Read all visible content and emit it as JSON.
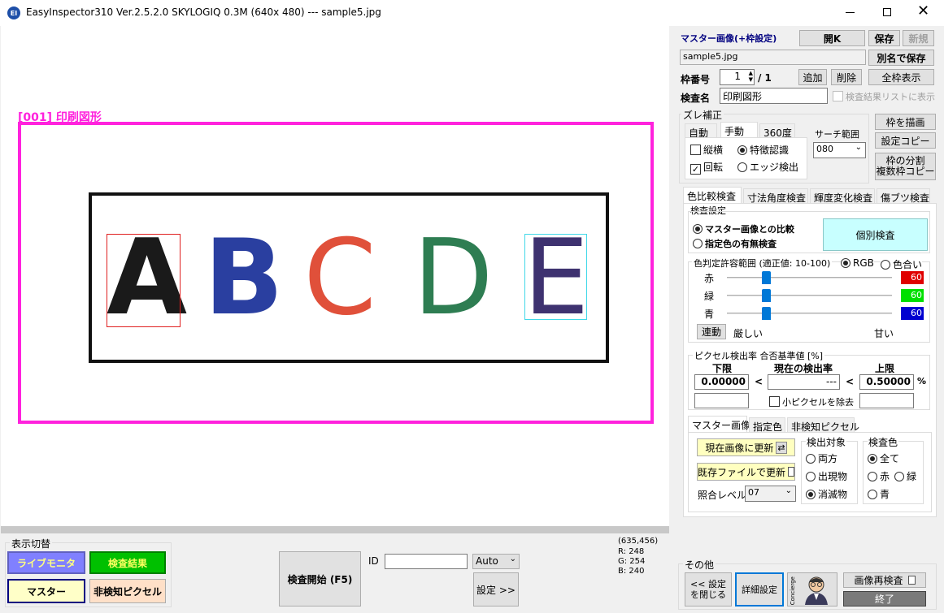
{
  "window": {
    "icon": "EI",
    "title": "EasyInspector310 Ver.2.5.2.0 SKYLOGIQ 0.3M   (640x 480) --- sample5.jpg"
  },
  "image": {
    "frame_label": "[001] 印刷図形",
    "letters": [
      "A",
      "B",
      "C",
      "D",
      "E"
    ],
    "colors": {
      "A": "#1a1a1a",
      "B": "#2a3fa0",
      "C": "#e0503a",
      "D": "#2e7d52",
      "E": "#3e3270",
      "frame": "#ff22dd"
    }
  },
  "bottom": {
    "display_group": "表示切替",
    "live_monitor": "ライブモニタ",
    "result": "検査結果",
    "master": "マスター",
    "non_detect": "非検知ピクセル",
    "start": "検査開始 (F5)",
    "id_label": "ID",
    "id_value": "",
    "auto": "Auto",
    "settings": "設定 >>",
    "coord": "(635,456)",
    "r": "R: 248",
    "g": "G: 254",
    "b": "B: 240",
    "other_group": "その他",
    "close_settings_1": "<< 設定",
    "close_settings_2": "を閉じる",
    "detail": "詳細設定",
    "concierge": "Concierge",
    "reinspect": "画像再検査",
    "exit": "終了"
  },
  "panel": {
    "master_title": "マスター画像(+枠設定)",
    "open": "開K",
    "save": "保存",
    "new": "新規",
    "filename": "sample5.jpg",
    "save_as": "別名で保存",
    "frame_no_label": "枠番号",
    "frame_no": "1",
    "frame_total": "/ 1",
    "add": "追加",
    "delete": "削除",
    "show_all": "全枠表示",
    "inspect_name_label": "検査名",
    "inspect_name": "印刷図形",
    "result_list": "検査結果リストに表示",
    "shift_group": "ズレ補正",
    "tabs": [
      "自動",
      "手動",
      "360度"
    ],
    "vert_horiz": "縦横",
    "rotate": "回転",
    "feature": "特徴認識",
    "edge": "エッジ検出",
    "search_range": "サーチ範囲",
    "search_value": "080",
    "draw_frame": "枠を描画",
    "copy_settings": "設定コピー",
    "split_1": "枠の分割",
    "split_2": "複数枠コピー",
    "main_tabs": [
      "色比較検査",
      "寸法角度検査",
      "輝度変化検査",
      "傷ブツ検査"
    ],
    "inspect_settings": "検査設定",
    "compare_master": "マスター画像との比較",
    "color_presence": "指定色の有無検査",
    "individual": "個別検査",
    "tolerance_label": "色判定許容範囲 (適正値: 10-100)",
    "rgb": "RGB",
    "hue": "色合い",
    "red": "赤",
    "green": "緑",
    "blue": "青",
    "rv": "60",
    "gv": "60",
    "bv": "60",
    "link": "連動",
    "strict": "厳しい",
    "loose": "甘い",
    "pixel_rate": "ピクセル検出率 合否基準値 [%]",
    "lower": "下限",
    "current": "現在の検出率",
    "upper": "上限",
    "lower_val": "0.00000",
    "current_val": "---",
    "upper_val": "0.50000",
    "lt": "<",
    "pct": "%",
    "remove_small": "小ピクセルを除去",
    "sub_tabs": [
      "マスター画像",
      "指定色",
      "非検知ピクセル"
    ],
    "update_current": "現在画像に更新",
    "update_file": "既存ファイルで更新",
    "match_level": "照合レベル",
    "match_value": "07",
    "detect_target": "検出対象",
    "both": "両方",
    "appear": "出現物",
    "vanish": "消滅物",
    "inspect_color": "検査色",
    "all": "全て",
    "c_red": "赤",
    "c_green": "緑",
    "c_blue": "青"
  }
}
